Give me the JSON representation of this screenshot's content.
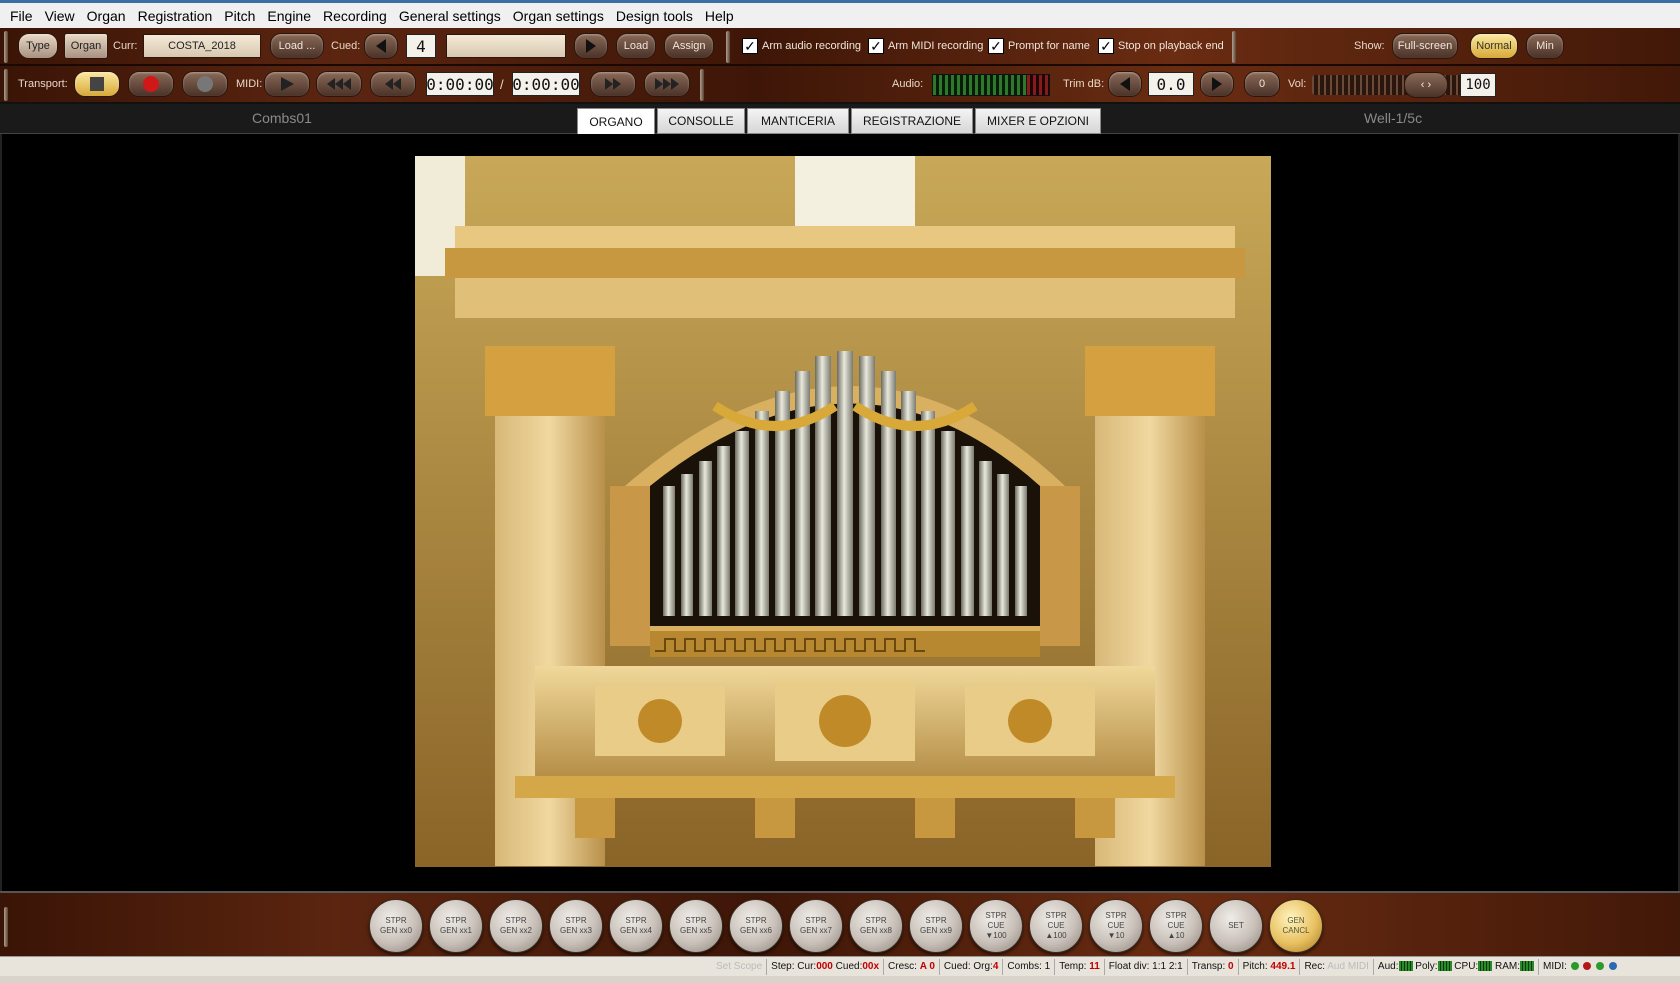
{
  "menu": [
    "File",
    "View",
    "Organ",
    "Registration",
    "Pitch",
    "Engine",
    "Recording",
    "General settings",
    "Organ settings",
    "Design tools",
    "Help"
  ],
  "toolbar1": {
    "type_btn": "Type",
    "organ_btn": "Organ",
    "curr_label": "Curr:",
    "curr_value": "COSTA_2018",
    "load_dots": "Load ...",
    "cued_label": "Cued:",
    "cued_value": "4",
    "load_btn": "Load",
    "assign_btn": "Assign",
    "arm_audio": "Arm audio recording",
    "arm_midi": "Arm MIDI recording",
    "prompt_name": "Prompt for name",
    "stop_playback": "Stop on playback end",
    "show_label": "Show:",
    "fullscreen_btn": "Full-screen",
    "normal_btn": "Normal",
    "min_btn": "Min"
  },
  "toolbar2": {
    "transport_label": "Transport:",
    "midi_label": "MIDI:",
    "time1": "0:00:00",
    "slash": "/",
    "time2": "0:00:00",
    "audio_label": "Audio:",
    "trim_label": "Trim dB:",
    "trim_value": "0.0",
    "zero_btn": "0",
    "vol_label": "Vol:",
    "vol_value": "100"
  },
  "tabs": {
    "left_label": "Combs01",
    "right_label": "Well-1/5c",
    "items": [
      "ORGANO",
      "CONSOLLE",
      "MANTICERIA",
      "REGISTRAZIONE",
      "MIXER E OPZIONI"
    ]
  },
  "pistons": [
    [
      "STPR",
      "GEN xx0"
    ],
    [
      "STPR",
      "GEN xx1"
    ],
    [
      "STPR",
      "GEN xx2"
    ],
    [
      "STPR",
      "GEN xx3"
    ],
    [
      "STPR",
      "GEN xx4"
    ],
    [
      "STPR",
      "GEN xx5"
    ],
    [
      "STPR",
      "GEN xx6"
    ],
    [
      "STPR",
      "GEN xx7"
    ],
    [
      "STPR",
      "GEN xx8"
    ],
    [
      "STPR",
      "GEN xx9"
    ],
    [
      "STPR",
      "CUE",
      "▼100"
    ],
    [
      "STPR",
      "CUE",
      "▲100"
    ],
    [
      "STPR",
      "CUE",
      "▼10"
    ],
    [
      "STPR",
      "CUE",
      "▲10"
    ],
    [
      "SET"
    ],
    [
      "GEN",
      "CANCL"
    ]
  ],
  "status": {
    "set_scope": "Set Scope",
    "step": "Step: Cur:",
    "step_cur": "000",
    "cued": "Cued:",
    "cued_val": "00x",
    "cresc": "Cresc:",
    "cresc_val": "A 0",
    "cued_org": "Cued: Org:",
    "cued_org_val": "4",
    "combs": "Combs: 1",
    "temp": "Temp:",
    "temp_val": "11",
    "float_div": "Float div: 1:1 2:1",
    "transp": "Transp:",
    "transp_val": "0",
    "pitch": "Pitch:",
    "pitch_val": "449.1",
    "rec": "Rec:",
    "rec_aud": "Aud",
    "rec_midi": "MIDI",
    "aud": "Aud:",
    "poly": "Poly:",
    "cpu": "CPU:",
    "ram": "RAM:",
    "midi": "MIDI:"
  },
  "colors": {
    "wood_dark": "#3a1406",
    "wood_mid": "#5b2510",
    "accent_gold": "#e8c060",
    "status_red": "#c00000",
    "led_green": "#2a9a2a",
    "led_red": "#b01818",
    "led_blue": "#2a6ab0"
  }
}
